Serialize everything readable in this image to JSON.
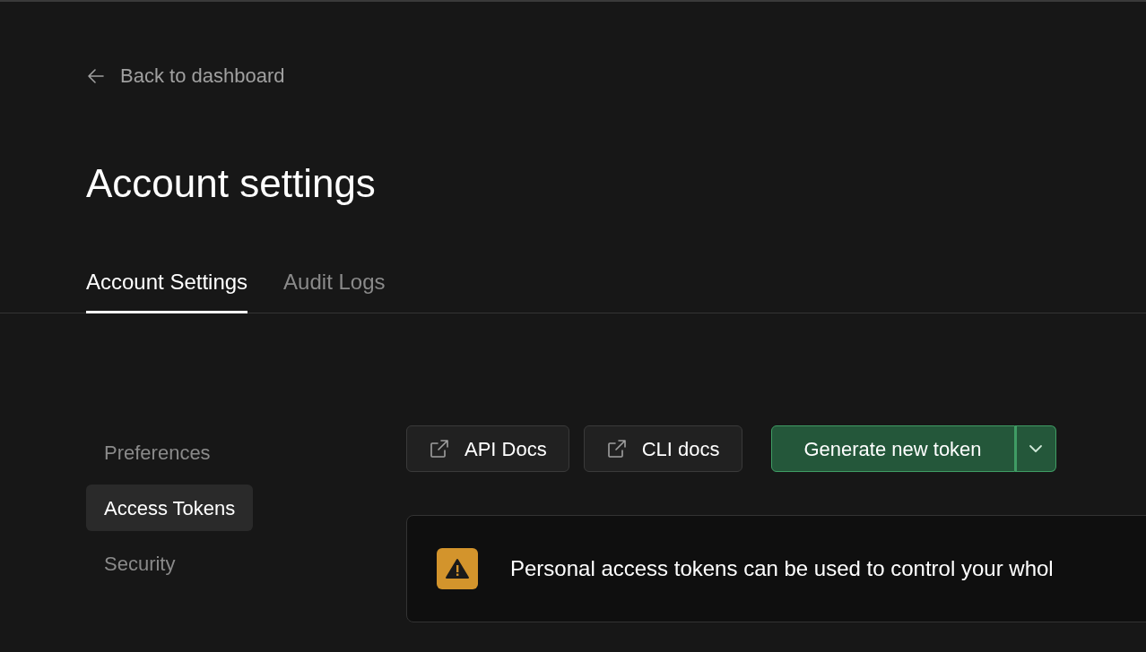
{
  "back_link": {
    "label": "Back to dashboard"
  },
  "page_title": "Account settings",
  "tabs": [
    {
      "label": "Account Settings",
      "selected": true
    },
    {
      "label": "Audit Logs",
      "selected": false
    }
  ],
  "sidebar": {
    "items": [
      {
        "label": "Preferences",
        "selected": false
      },
      {
        "label": "Access Tokens",
        "selected": true
      },
      {
        "label": "Security",
        "selected": false
      }
    ]
  },
  "toolbar": {
    "doc_links": [
      "API Docs",
      "CLI docs"
    ],
    "primary_button": "Generate new token"
  },
  "warning": {
    "text": "Personal access tokens can be used to control your whol"
  }
}
